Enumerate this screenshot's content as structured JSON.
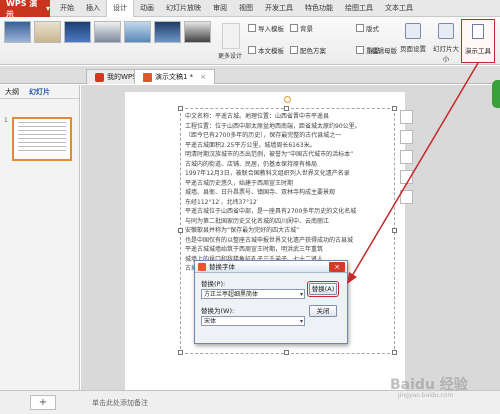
{
  "app": {
    "name": "WPS 演示"
  },
  "menu": {
    "items": [
      "开始",
      "插入",
      "设计",
      "动画",
      "幻灯片放映",
      "审阅",
      "视图",
      "开发工具",
      "特色功能",
      "绘图工具",
      "文本工具"
    ],
    "active_index": 2
  },
  "ribbon": {
    "more_designs": "更多设计",
    "import_template": "导入模板",
    "text_template": "本文模板",
    "background": "背景",
    "color_scheme": "配色方案",
    "layout": "版式",
    "rearrange": "重置",
    "edit_master": "编辑母版",
    "page_setup": "页面设置",
    "slide_size": "幻灯片大小",
    "presenter_tools": "演示工具"
  },
  "tabs": {
    "items": [
      {
        "label": "我的WPS",
        "active": false
      },
      {
        "label": "演示文稿1 *",
        "active": true
      }
    ]
  },
  "side_panel": {
    "tabs": [
      "大纲",
      "幻灯片"
    ],
    "active_tab": 1,
    "slide_number": "1"
  },
  "slide_text": [
    "中文名称：平遥古城。地理位置：山西省晋中市平遥县",
    "工程位置：位于山西中部太原盆地西南端，距省城太原约90公里。",
    "（距今已有2700多年的历史），保存最完整的古代县城之一",
    "平遥古城面积2.25平方公里，城墙周长6163米。",
    "明清时期汉族城市的杰出范例，被誉为“中国古代城市的活标本”",
    "古城内的街道、店铺、民居，仍基本保持原有格局",
    "1997年12月3日，被联合国教科文组织列入世界文化遗产名录",
    "平遥古城历史悠久，始建于西周宣王时期",
    "城墙、县衙、日升昌票号、镇国寺、双林寺构成主要景观",
    "东经112°12′，北纬37°12′",
    "平遥古城位于山西省中部，是一座具有2700多年历史的文化名城",
    "与同为第二批国家历史文化名城的四川阆中、云南丽江",
    "安徽歙县并称为“保存最为完好的四大古城”",
    "也是中国仅有的以整座古城申报世界文化遗产获得成功的古县城",
    "平遥古城城墙始筑于西周宣王时期，明洪武三年重筑",
    "城墙上的垛口和敌楼象征孔子三千弟子、七十二贤人",
    "古城内现有保存较为完整的传统民居3797处"
  ],
  "dialog": {
    "title": "替换字体",
    "replace_label": "替换(P):",
    "replace_value": "方正兰亭超细黑简体",
    "with_label": "替换为(W):",
    "with_value": "宋体",
    "replace_button": "替换(A)",
    "close_button": "关闭"
  },
  "notes": {
    "placeholder": "单击此处添加备注"
  },
  "watermark": {
    "text": "Baidu 经验",
    "sub": "jingyan.baidu.com"
  },
  "colors": {
    "app_red": "#c8341e",
    "annotation": "#c62828"
  }
}
